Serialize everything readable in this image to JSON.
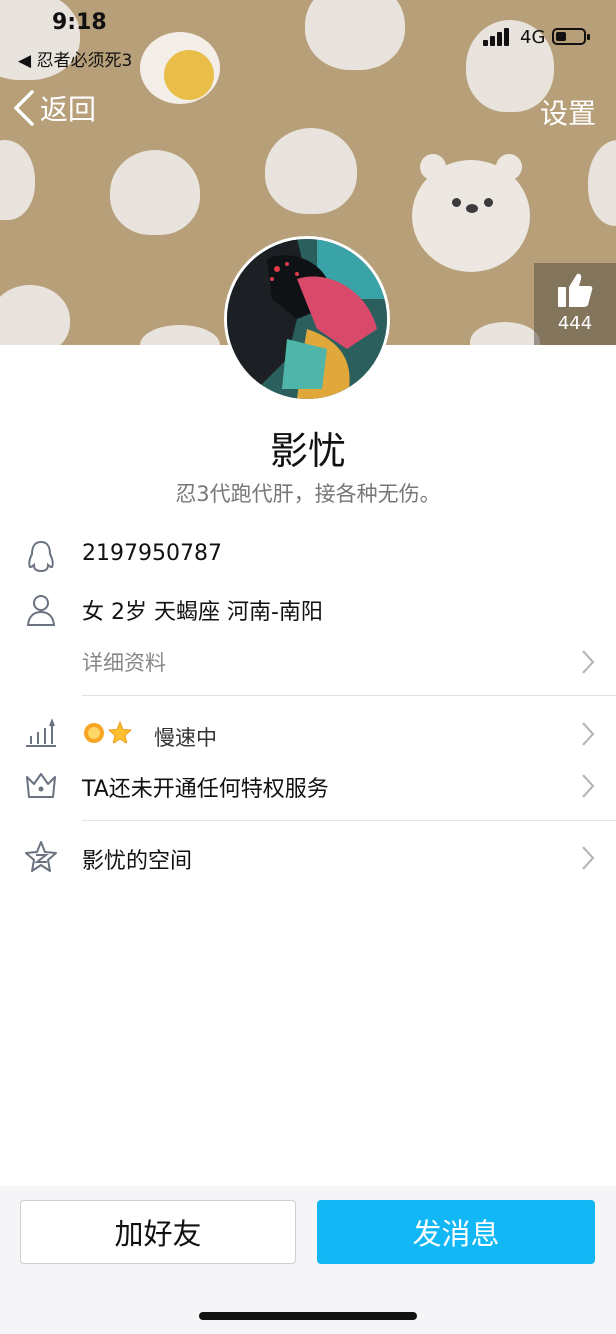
{
  "status_bar": {
    "time": "9:18",
    "back_app": "◀ 忍者必须死3",
    "network": "4G"
  },
  "nav": {
    "back_label": "返回",
    "settings_label": "设置"
  },
  "like": {
    "count": "444"
  },
  "profile": {
    "name": "影忧",
    "signature": "忍3代跑代肝，接各种无伤。"
  },
  "info": {
    "qq_number": "2197950787",
    "basic_info": "女 2岁 天蝎座 河南-南阳",
    "detail_link": "详细资料",
    "level_status": "慢速中",
    "privilege_text": "TA还未开通任何特权服务",
    "space_link": "影忧的空间"
  },
  "footer": {
    "add_friend_label": "加好友",
    "send_message_label": "发消息"
  },
  "colors": {
    "banner_bg": "#b79f79",
    "accent_blue": "#12b7f5"
  }
}
